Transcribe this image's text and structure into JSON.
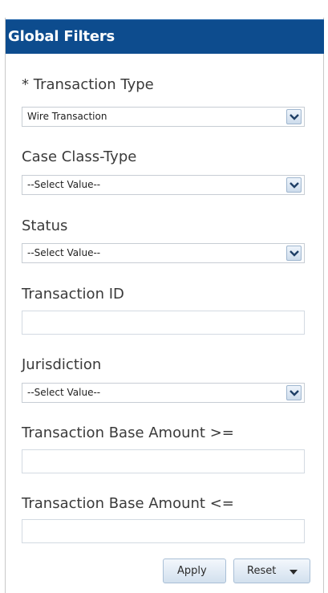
{
  "header": {
    "title": "Global Filters"
  },
  "filters": {
    "transaction_type": {
      "label": "* Transaction Type",
      "value": "Wire Transaction"
    },
    "case_class_type": {
      "label": "Case Class-Type",
      "value": "--Select Value--"
    },
    "status": {
      "label": "Status",
      "value": "--Select Value--"
    },
    "transaction_id": {
      "label": "Transaction ID",
      "value": ""
    },
    "jurisdiction": {
      "label": "Jurisdiction",
      "value": "--Select Value--"
    },
    "amount_min": {
      "label": "Transaction Base Amount >=",
      "value": ""
    },
    "amount_max": {
      "label": "Transaction Base Amount <=",
      "value": ""
    }
  },
  "buttons": {
    "apply": "Apply",
    "reset": "Reset"
  },
  "icons": {
    "dropdown": "chevron-down-icon",
    "reset_menu": "caret-down-icon"
  },
  "colors": {
    "header_bg": "#0d4c8e",
    "header_text": "#ffffff"
  }
}
